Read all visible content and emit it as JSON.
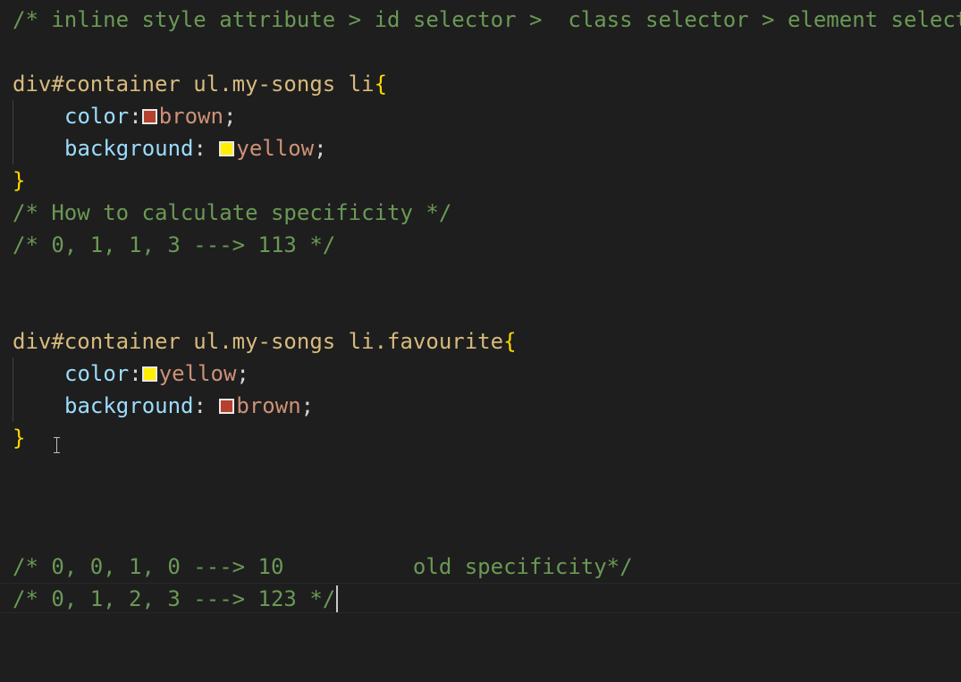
{
  "editor": {
    "line1": "/* inline style attribute > id selector >  class selector > element selector */",
    "rule1": {
      "selector": "div#container ul.my-songs li",
      "open": "{",
      "close": "}",
      "decl1": {
        "prop": "color",
        "colon": ":",
        "value": "brown",
        "semi": ";",
        "swatch": "#b5402e"
      },
      "decl2": {
        "prop": "background",
        "colon": ": ",
        "value": "yellow",
        "semi": ";",
        "swatch": "#ffee00"
      }
    },
    "comment2": "/* How to calculate specificity */",
    "comment3": "/* 0, 1, 1, 3 ---> 113 */",
    "rule2": {
      "selector": "div#container ul.my-songs li.favourite",
      "open": "{",
      "close": "}",
      "decl1": {
        "prop": "color",
        "colon": ":",
        "value": "yellow",
        "semi": ";",
        "swatch": "#ffee00"
      },
      "decl2": {
        "prop": "background",
        "colon": ": ",
        "value": "brown",
        "semi": ";",
        "swatch": "#b5402e"
      }
    },
    "comment4": "/* 0, 0, 1, 0 ---> 10          old specificity*/",
    "comment5": "/* 0, 1, 2, 3 ---> 123 */"
  },
  "colors": {
    "background": "#1e1e1e",
    "comment": "#6a9955",
    "selector": "#d7ba7d",
    "brace": "#ffd700",
    "property": "#9cdcfe",
    "value": "#ce9178"
  }
}
